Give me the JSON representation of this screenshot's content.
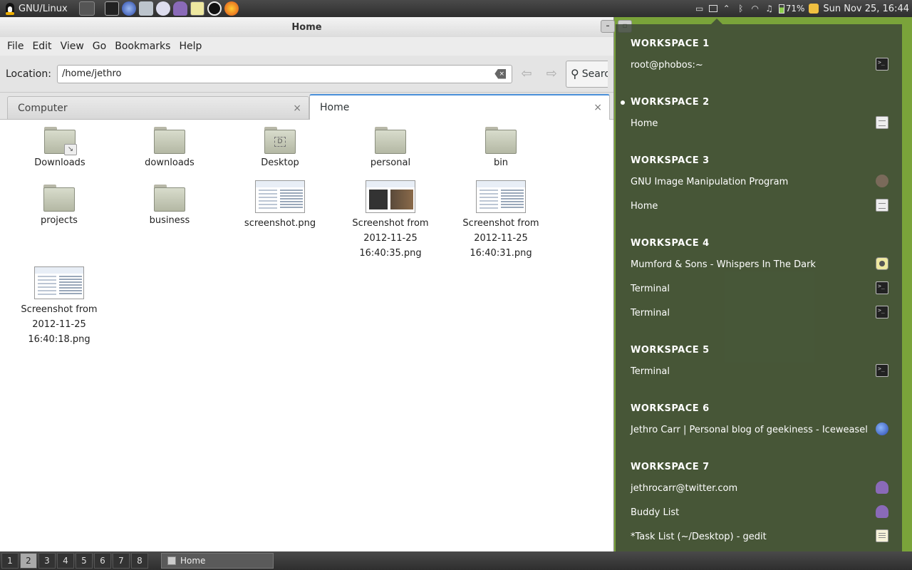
{
  "top_panel": {
    "menu_label": "GNU/Linux",
    "launchers": [
      "files-launcher",
      "terminal-launcher",
      "browser-launcher",
      "network-launcher",
      "mail-launcher",
      "pidgin-launcher",
      "media-launcher",
      "rabbit-launcher",
      "firefox-launcher"
    ],
    "battery": "71%",
    "clock": "Sun Nov 25, 16:44"
  },
  "window": {
    "title": "Home",
    "menus": [
      "File",
      "Edit",
      "View",
      "Go",
      "Bookmarks",
      "Help"
    ],
    "location_label": "Location:",
    "location_value": "/home/jethro",
    "search_label": "Search",
    "tabs": [
      {
        "label": "Computer",
        "active": false
      },
      {
        "label": "Home",
        "active": true
      }
    ],
    "files": [
      {
        "label": "Downloads",
        "kind": "folder-link"
      },
      {
        "label": "downloads",
        "kind": "folder"
      },
      {
        "label": "Desktop",
        "kind": "folder-desktop"
      },
      {
        "label": "personal",
        "kind": "folder"
      },
      {
        "label": "bin",
        "kind": "folder"
      },
      {
        "label": "projects",
        "kind": "folder"
      },
      {
        "label": "business",
        "kind": "folder"
      },
      {
        "label": "screenshot.png",
        "kind": "image"
      },
      {
        "label": "Screenshot from 2012-11-25 16:40:35.png",
        "kind": "image-dark"
      },
      {
        "label": "Screenshot from 2012-11-25 16:40:31.png",
        "kind": "image"
      },
      {
        "label": "Screenshot from 2012-11-25 16:40:18.png",
        "kind": "image"
      }
    ]
  },
  "workspaces": [
    {
      "heading": "WORKSPACE 1",
      "current": false,
      "windows": [
        {
          "title": "root@phobos:~",
          "icon": "terminal-icon"
        }
      ]
    },
    {
      "heading": "WORKSPACE 2",
      "current": true,
      "windows": [
        {
          "title": "Home",
          "icon": "file-manager-icon"
        }
      ]
    },
    {
      "heading": "WORKSPACE 3",
      "current": false,
      "windows": [
        {
          "title": "GNU Image Manipulation Program",
          "icon": "gimp-icon"
        },
        {
          "title": "Home",
          "icon": "file-manager-icon"
        }
      ]
    },
    {
      "heading": "WORKSPACE 4",
      "current": false,
      "windows": [
        {
          "title": "Mumford & Sons - Whispers In The Dark",
          "icon": "music-player-icon"
        },
        {
          "title": "Terminal",
          "icon": "terminal-icon"
        },
        {
          "title": "Terminal",
          "icon": "terminal-icon"
        }
      ]
    },
    {
      "heading": "WORKSPACE 5",
      "current": false,
      "windows": [
        {
          "title": "Terminal",
          "icon": "terminal-icon"
        }
      ]
    },
    {
      "heading": "WORKSPACE 6",
      "current": false,
      "windows": [
        {
          "title": "Jethro Carr | Personal blog of geekiness - Iceweasel",
          "icon": "iceweasel-icon"
        }
      ]
    },
    {
      "heading": "WORKSPACE 7",
      "current": false,
      "windows": [
        {
          "title": "jethrocarr@twitter.com",
          "icon": "pidgin-icon"
        },
        {
          "title": "Buddy List",
          "icon": "pidgin-icon"
        },
        {
          "title": "*Task List (~/Desktop) - gedit",
          "icon": "gedit-icon"
        }
      ]
    }
  ],
  "bottom_panel": {
    "workspace_buttons": [
      "1",
      "2",
      "3",
      "4",
      "5",
      "6",
      "7",
      "8"
    ],
    "active_workspace": "2",
    "task_label": "Home"
  },
  "colors": {
    "panel_bg": "#2e2e2e",
    "desktop_green": "#7aa33a",
    "tab_accent": "#4a90d9",
    "overlay_bg": "#3c4637"
  }
}
